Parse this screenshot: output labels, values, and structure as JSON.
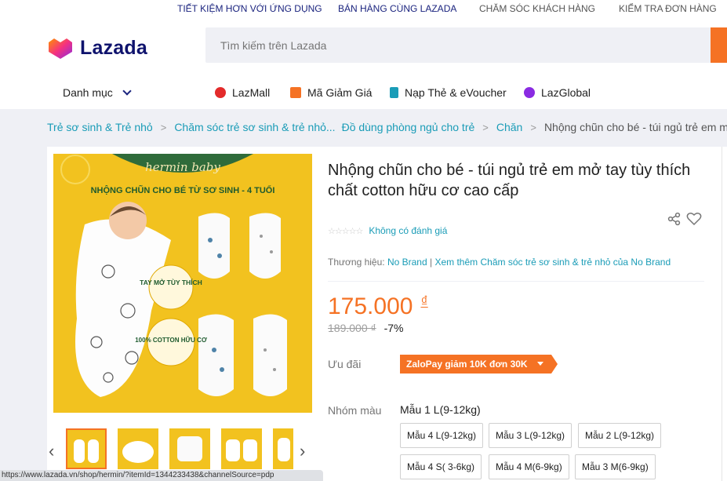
{
  "topbar": {
    "links": [
      "TIẾT KIỆM HƠN VỚI ỨNG DỤNG",
      "BÁN HÀNG CÙNG LAZADA",
      "CHĂM SÓC KHÁCH HÀNG",
      "KIỂM TRA ĐƠN HÀNG"
    ]
  },
  "header": {
    "logo_text": "Lazada",
    "search_placeholder": "Tìm kiếm trên Lazada",
    "category_label": "Danh mục",
    "nav": [
      "LazMall",
      "Mã Giảm Giá",
      "Nạp Thẻ & eVoucher",
      "LazGlobal"
    ]
  },
  "breadcrumb": [
    "Trẻ sơ sinh & Trẻ nhỏ",
    "Chăm sóc trẻ sơ sinh & trẻ nhỏ...",
    "Đồ dùng phòng ngủ cho trẻ",
    "Chăn",
    "Nhộng chũn cho bé - túi ngủ trẻ em mở t"
  ],
  "product": {
    "title": "Nhộng chũn cho bé - túi ngủ trẻ em mở tay tùy thích chất cotton hữu cơ cao cấp",
    "rating_text": "Không có đánh giá",
    "brand_label": "Thương hiệu:",
    "brand": "No Brand",
    "brand_more": "Xem thêm Chăm sóc trẻ sơ sinh & trẻ nhỏ của No Brand",
    "price": "175.000",
    "currency": "₫",
    "old_price": "189.000 ₫",
    "discount": "-7%",
    "promo_label": "Ưu đãi",
    "promo": "ZaloPay giảm 10K đơn 30K",
    "color_label": "Nhóm màu",
    "color_selected": "Mẫu 1 L(9-12kg)",
    "options": [
      "Mẫu 4 L(9-12kg)",
      "Mẫu 3 L(9-12kg)",
      "Mẫu 2 L(9-12kg)",
      "Mẫu 4 S( 3-6kg)",
      "Mẫu 4 M(6-9kg)",
      "Mẫu 3 M(6-9kg)"
    ]
  },
  "image_text": {
    "brand": "hermin baby",
    "headline": "NHỘNG CHŨN CHO BÉ TỪ SƠ SINH - 4 TUỔI",
    "badge1": "TAY MỞ TÙY THÍCH",
    "badge2": "100% COTTON HỮU CƠ"
  },
  "status_url": "https://www.lazada.vn/shop/hermin/?itemId=1344233438&channelSource=pdp",
  "colors": {
    "accent": "#f57224",
    "link": "#1a9cb7",
    "navy": "#0f136d",
    "image_bg": "#f2c21f"
  }
}
